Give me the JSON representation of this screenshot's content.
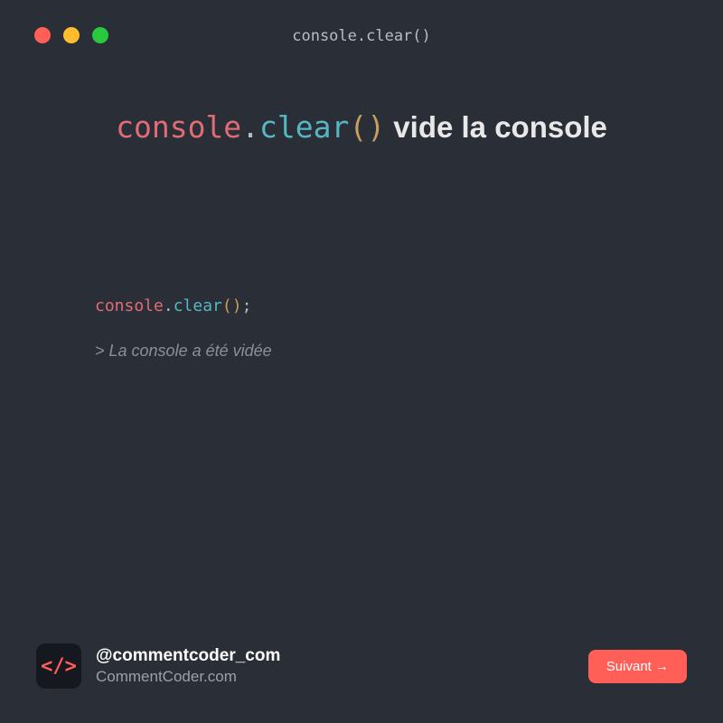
{
  "window": {
    "title": "console.clear()"
  },
  "headline": {
    "code_obj": "console",
    "code_dot": ".",
    "code_method": "clear",
    "code_paren_open": "(",
    "code_paren_close": ")",
    "text_after": " vide la console"
  },
  "code": {
    "obj": "console",
    "dot": ".",
    "method": "clear",
    "paren_open": "(",
    "paren_close": ")",
    "semi": ";"
  },
  "output": {
    "text": "> La console a été vidée"
  },
  "footer": {
    "logo_text": "</>",
    "handle": "@commentcoder_com",
    "site": "CommentCoder.com",
    "button_label": "Suivant →"
  },
  "colors": {
    "bg": "#2a2e37",
    "red": "#ff5f56",
    "yellow": "#ffbd2e",
    "green": "#27c93f",
    "obj": "#e06c75",
    "method": "#56b6c2",
    "paren": "#c89e5f"
  }
}
